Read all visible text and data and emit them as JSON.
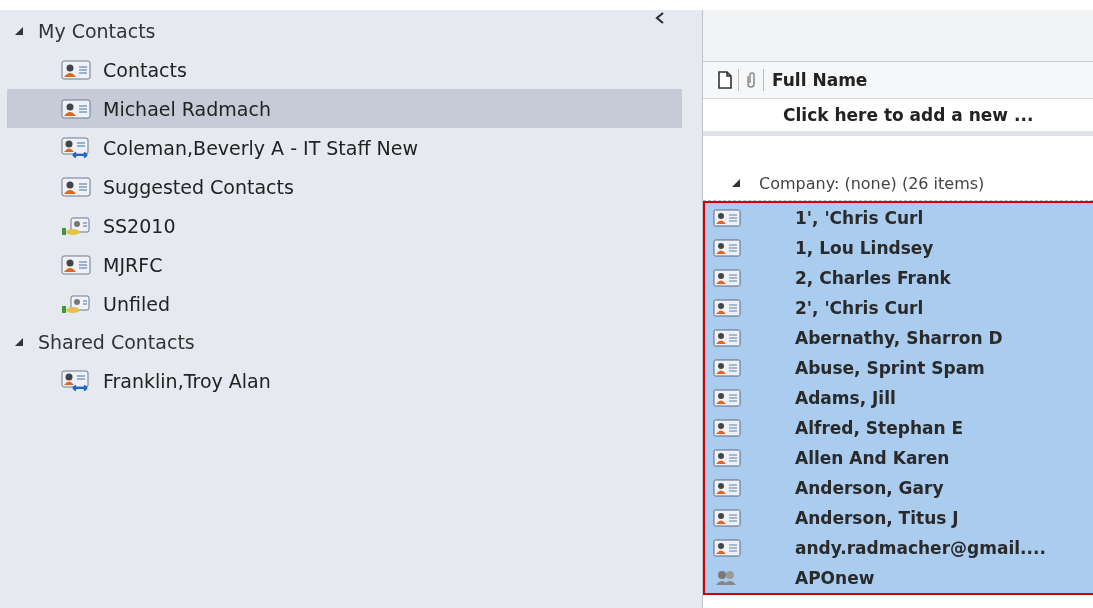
{
  "folder_tree": [
    {
      "label": "My Contacts",
      "expanded": true,
      "children": [
        {
          "label": "Contacts",
          "kind": "contact",
          "selected": false
        },
        {
          "label": "Michael Radmach",
          "kind": "contact",
          "selected": true
        },
        {
          "label": "Coleman,Beverly A - IT Staff New",
          "kind": "shared",
          "selected": false
        },
        {
          "label": "Suggested Contacts",
          "kind": "contact",
          "selected": false
        },
        {
          "label": "SS2010",
          "kind": "public",
          "selected": false
        },
        {
          "label": "MJRFC",
          "kind": "contact",
          "selected": false
        },
        {
          "label": "Unfiled",
          "kind": "public",
          "selected": false
        }
      ]
    },
    {
      "label": "Shared Contacts",
      "expanded": true,
      "children": [
        {
          "label": "Franklin,Troy Alan",
          "kind": "shared",
          "selected": false
        }
      ]
    }
  ],
  "contact_list": {
    "column": "Full Name",
    "new_item_prompt": "Click here to add a new ...",
    "group": {
      "label": "Company: (none) (26 items)",
      "expanded": true
    },
    "rows": [
      {
        "name": "1', 'Chris Curl",
        "kind": "contact",
        "selected": true
      },
      {
        "name": "1, Lou Lindsey",
        "kind": "contact",
        "selected": true
      },
      {
        "name": "2, Charles Frank",
        "kind": "contact",
        "selected": true
      },
      {
        "name": "2', 'Chris Curl",
        "kind": "contact",
        "selected": true
      },
      {
        "name": "Abernathy, Sharron D",
        "kind": "contact",
        "selected": true
      },
      {
        "name": "Abuse, Sprint Spam",
        "kind": "contact",
        "selected": true
      },
      {
        "name": "Adams, Jill",
        "kind": "contact",
        "selected": true
      },
      {
        "name": "Alfred, Stephan E",
        "kind": "contact",
        "selected": true
      },
      {
        "name": "Allen And Karen",
        "kind": "contact",
        "selected": true
      },
      {
        "name": "Anderson, Gary",
        "kind": "contact",
        "selected": true
      },
      {
        "name": "Anderson, Titus J",
        "kind": "contact",
        "selected": true
      },
      {
        "name": "andy.radmacher@gmail....",
        "kind": "contact",
        "selected": true
      },
      {
        "name": "APOnew",
        "kind": "group",
        "selected": true
      }
    ]
  }
}
